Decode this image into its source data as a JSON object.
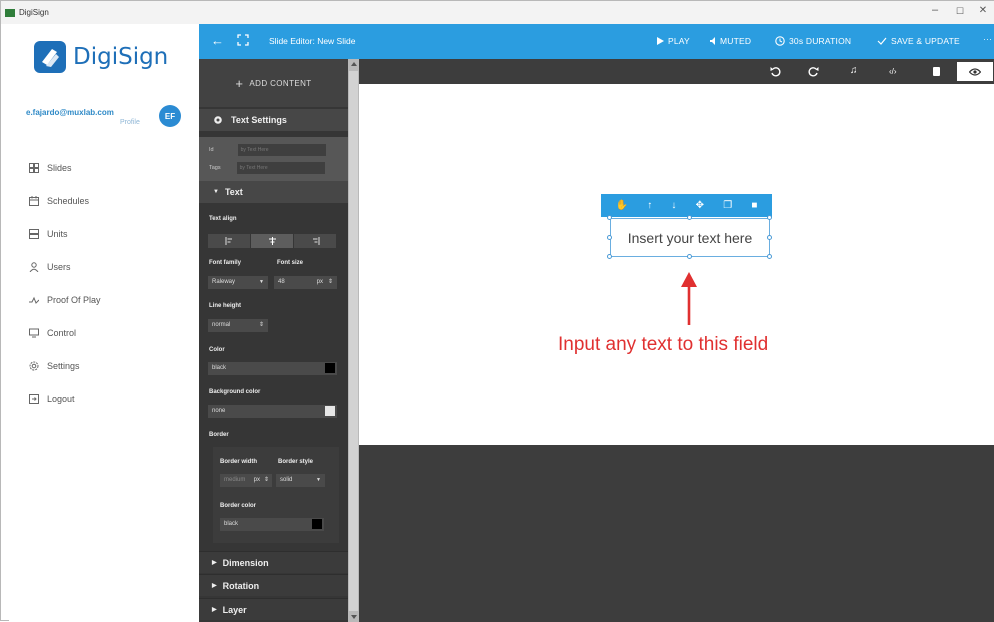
{
  "window": {
    "title": "DigiSign",
    "controls": [
      "–",
      "☐",
      "✕"
    ]
  },
  "sidebar": {
    "logo_text": "DigiSign",
    "user_email": "e.fajardo@muxlab.com",
    "user_profile": "Profile",
    "avatar_initials": "EF",
    "items": [
      {
        "label": "Slides",
        "icon": "grid-icon"
      },
      {
        "label": "Schedules",
        "icon": "calendar-icon"
      },
      {
        "label": "Units",
        "icon": "server-icon"
      },
      {
        "label": "Users",
        "icon": "user-icon"
      },
      {
        "label": "Proof Of Play",
        "icon": "pulse-icon"
      },
      {
        "label": "Control",
        "icon": "monitor-icon"
      },
      {
        "label": "Settings",
        "icon": "gear-icon"
      },
      {
        "label": "Logout",
        "icon": "logout-icon"
      }
    ]
  },
  "topbar": {
    "title": "Slide Editor: New Slide",
    "play": "PLAY",
    "muted": "MUTED",
    "duration": "30s DURATION",
    "save": "SAVE & UPDATE",
    "more": "···"
  },
  "panel": {
    "add_content": "ADD CONTENT",
    "text_settings": "Text Settings",
    "id_label": "Id",
    "id_placeholder": "by Text Here",
    "tags_label": "Tags",
    "tags_placeholder": "by Text Here",
    "text_section": "Text",
    "text_align_label": "Text align",
    "font_family_label": "Font family",
    "font_family_value": "Raleway",
    "font_size_label": "Font size",
    "font_size_value": "48",
    "font_size_unit": "px",
    "line_height_label": "Line height",
    "line_height_value": "normal",
    "color_label": "Color",
    "color_value": "black",
    "bg_color_label": "Background color",
    "bg_color_value": "none",
    "border_label": "Border",
    "border_width_label": "Border width",
    "border_width_value": "medium",
    "border_width_unit": "px",
    "border_style_label": "Border style",
    "border_style_value": "solid",
    "border_color_label": "Border color",
    "border_color_value": "black",
    "dimension": "Dimension",
    "rotation": "Rotation",
    "layer": "Layer"
  },
  "canvas": {
    "text_element": "Insert your text here",
    "annotation": "Input any text to this field"
  },
  "colors": {
    "accent": "#2b9de0",
    "panel_bg": "#363636",
    "annotation": "#e03030"
  }
}
